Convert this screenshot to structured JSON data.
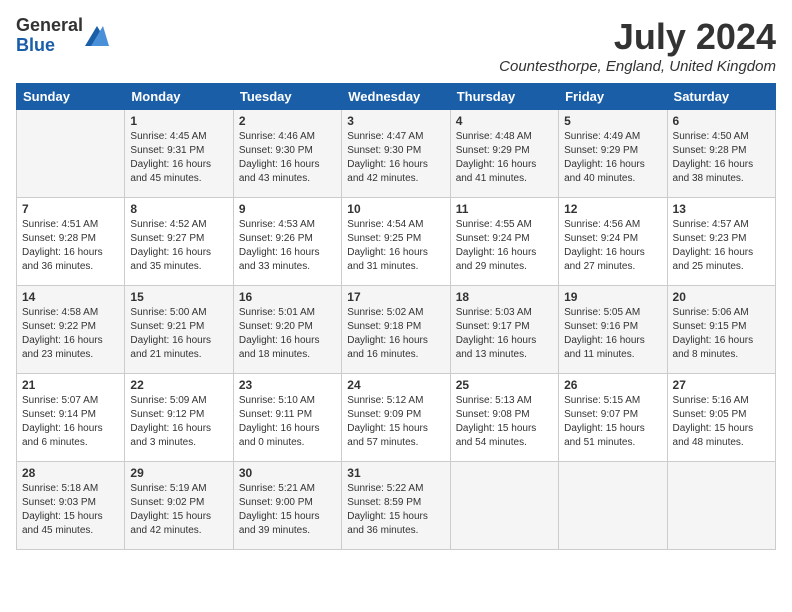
{
  "logo": {
    "general": "General",
    "blue": "Blue"
  },
  "title": "July 2024",
  "location": "Countesthorpe, England, United Kingdom",
  "headers": [
    "Sunday",
    "Monday",
    "Tuesday",
    "Wednesday",
    "Thursday",
    "Friday",
    "Saturday"
  ],
  "weeks": [
    [
      {
        "day": "",
        "info": ""
      },
      {
        "day": "1",
        "info": "Sunrise: 4:45 AM\nSunset: 9:31 PM\nDaylight: 16 hours\nand 45 minutes."
      },
      {
        "day": "2",
        "info": "Sunrise: 4:46 AM\nSunset: 9:30 PM\nDaylight: 16 hours\nand 43 minutes."
      },
      {
        "day": "3",
        "info": "Sunrise: 4:47 AM\nSunset: 9:30 PM\nDaylight: 16 hours\nand 42 minutes."
      },
      {
        "day": "4",
        "info": "Sunrise: 4:48 AM\nSunset: 9:29 PM\nDaylight: 16 hours\nand 41 minutes."
      },
      {
        "day": "5",
        "info": "Sunrise: 4:49 AM\nSunset: 9:29 PM\nDaylight: 16 hours\nand 40 minutes."
      },
      {
        "day": "6",
        "info": "Sunrise: 4:50 AM\nSunset: 9:28 PM\nDaylight: 16 hours\nand 38 minutes."
      }
    ],
    [
      {
        "day": "7",
        "info": "Sunrise: 4:51 AM\nSunset: 9:28 PM\nDaylight: 16 hours\nand 36 minutes."
      },
      {
        "day": "8",
        "info": "Sunrise: 4:52 AM\nSunset: 9:27 PM\nDaylight: 16 hours\nand 35 minutes."
      },
      {
        "day": "9",
        "info": "Sunrise: 4:53 AM\nSunset: 9:26 PM\nDaylight: 16 hours\nand 33 minutes."
      },
      {
        "day": "10",
        "info": "Sunrise: 4:54 AM\nSunset: 9:25 PM\nDaylight: 16 hours\nand 31 minutes."
      },
      {
        "day": "11",
        "info": "Sunrise: 4:55 AM\nSunset: 9:24 PM\nDaylight: 16 hours\nand 29 minutes."
      },
      {
        "day": "12",
        "info": "Sunrise: 4:56 AM\nSunset: 9:24 PM\nDaylight: 16 hours\nand 27 minutes."
      },
      {
        "day": "13",
        "info": "Sunrise: 4:57 AM\nSunset: 9:23 PM\nDaylight: 16 hours\nand 25 minutes."
      }
    ],
    [
      {
        "day": "14",
        "info": "Sunrise: 4:58 AM\nSunset: 9:22 PM\nDaylight: 16 hours\nand 23 minutes."
      },
      {
        "day": "15",
        "info": "Sunrise: 5:00 AM\nSunset: 9:21 PM\nDaylight: 16 hours\nand 21 minutes."
      },
      {
        "day": "16",
        "info": "Sunrise: 5:01 AM\nSunset: 9:20 PM\nDaylight: 16 hours\nand 18 minutes."
      },
      {
        "day": "17",
        "info": "Sunrise: 5:02 AM\nSunset: 9:18 PM\nDaylight: 16 hours\nand 16 minutes."
      },
      {
        "day": "18",
        "info": "Sunrise: 5:03 AM\nSunset: 9:17 PM\nDaylight: 16 hours\nand 13 minutes."
      },
      {
        "day": "19",
        "info": "Sunrise: 5:05 AM\nSunset: 9:16 PM\nDaylight: 16 hours\nand 11 minutes."
      },
      {
        "day": "20",
        "info": "Sunrise: 5:06 AM\nSunset: 9:15 PM\nDaylight: 16 hours\nand 8 minutes."
      }
    ],
    [
      {
        "day": "21",
        "info": "Sunrise: 5:07 AM\nSunset: 9:14 PM\nDaylight: 16 hours\nand 6 minutes."
      },
      {
        "day": "22",
        "info": "Sunrise: 5:09 AM\nSunset: 9:12 PM\nDaylight: 16 hours\nand 3 minutes."
      },
      {
        "day": "23",
        "info": "Sunrise: 5:10 AM\nSunset: 9:11 PM\nDaylight: 16 hours\nand 0 minutes."
      },
      {
        "day": "24",
        "info": "Sunrise: 5:12 AM\nSunset: 9:09 PM\nDaylight: 15 hours\nand 57 minutes."
      },
      {
        "day": "25",
        "info": "Sunrise: 5:13 AM\nSunset: 9:08 PM\nDaylight: 15 hours\nand 54 minutes."
      },
      {
        "day": "26",
        "info": "Sunrise: 5:15 AM\nSunset: 9:07 PM\nDaylight: 15 hours\nand 51 minutes."
      },
      {
        "day": "27",
        "info": "Sunrise: 5:16 AM\nSunset: 9:05 PM\nDaylight: 15 hours\nand 48 minutes."
      }
    ],
    [
      {
        "day": "28",
        "info": "Sunrise: 5:18 AM\nSunset: 9:03 PM\nDaylight: 15 hours\nand 45 minutes."
      },
      {
        "day": "29",
        "info": "Sunrise: 5:19 AM\nSunset: 9:02 PM\nDaylight: 15 hours\nand 42 minutes."
      },
      {
        "day": "30",
        "info": "Sunrise: 5:21 AM\nSunset: 9:00 PM\nDaylight: 15 hours\nand 39 minutes."
      },
      {
        "day": "31",
        "info": "Sunrise: 5:22 AM\nSunset: 8:59 PM\nDaylight: 15 hours\nand 36 minutes."
      },
      {
        "day": "",
        "info": ""
      },
      {
        "day": "",
        "info": ""
      },
      {
        "day": "",
        "info": ""
      }
    ]
  ]
}
